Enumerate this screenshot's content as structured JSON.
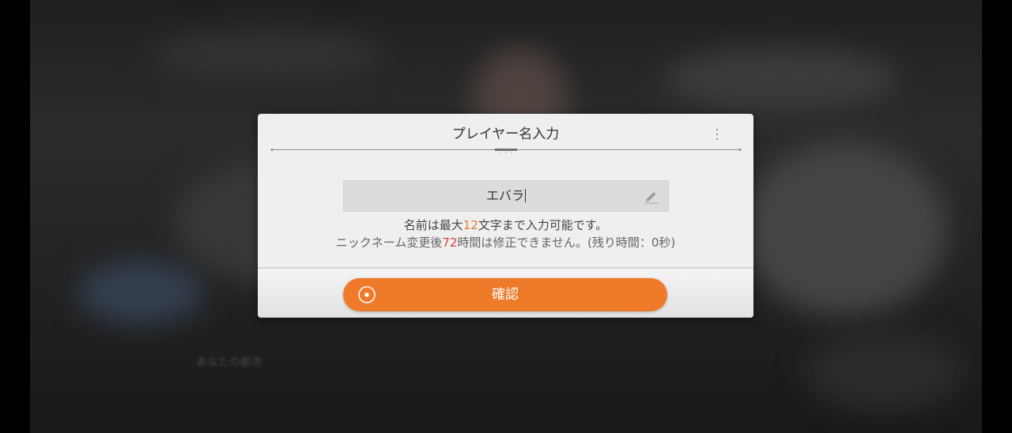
{
  "dialog": {
    "title": "プレイヤー名入力",
    "name_input": {
      "value": "エバラ"
    },
    "hint_line1": {
      "before": "名前は最大",
      "max_chars": "12",
      "after": "文字まで入力可能です。"
    },
    "hint_line2": {
      "before": "ニックネーム変更後",
      "hours": "72",
      "after": "時間は修正できません。(残り時間：0秒)"
    },
    "confirm_label": "確認"
  },
  "background": {
    "blurred_text": "あなたの都市"
  },
  "colors": {
    "accent_orange": "#ef7a2a",
    "highlight_red": "#d6403c",
    "dialog_bg": "#efefef"
  },
  "icons": {
    "menu": "vertical-dots-icon",
    "edit": "pencil-icon",
    "confirm": "target-circle-icon"
  }
}
